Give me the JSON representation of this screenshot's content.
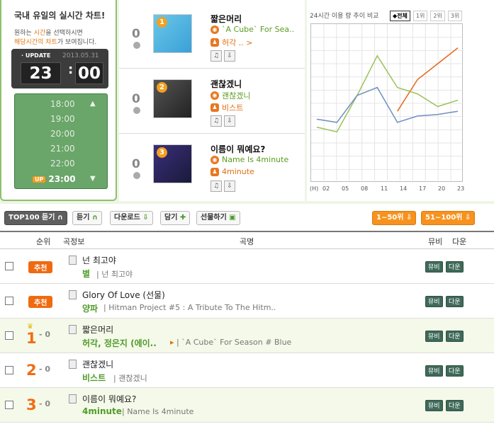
{
  "left": {
    "title": "국내 유일의 실시간 차트!",
    "sub1": "원하는 ",
    "sub_hl1": "시간",
    "sub2": "을 선택하시면",
    "sub_hl2": "해당시간의 차트",
    "sub3": "가 보여집니다.",
    "update_label": "· UPDATE",
    "update_date": "2013.05.31",
    "hour": "23",
    "minute": "00",
    "times": [
      "18:00",
      "19:00",
      "20:00",
      "21:00",
      "22:00"
    ],
    "up_badge": "UP",
    "current_time": "23:00"
  },
  "top_chart": [
    {
      "rank": "1",
      "change": "0",
      "title": "짧은머리",
      "album": "`A Cube` For Sea..",
      "artist": "허각 .. >"
    },
    {
      "rank": "2",
      "change": "0",
      "title": "괜찮겠니",
      "album": "괜찮겠니",
      "artist": "비스트"
    },
    {
      "rank": "3",
      "change": "0",
      "title": "이름이 뭐예요?",
      "album": "Name Is 4minute",
      "artist": "4minute"
    }
  ],
  "graph": {
    "title": "24시간 이용 량 추이 비교",
    "legend": [
      "◆전체",
      "1위",
      "2위",
      "3위"
    ],
    "x_label": "(H)",
    "x_ticks": [
      "02",
      "05",
      "08",
      "11",
      "14",
      "17",
      "20",
      "23"
    ],
    "colors": {
      "rank1": "#e8671a",
      "rank2": "#9cc25a",
      "rank3": "#6f8fc0"
    }
  },
  "chart_data": {
    "type": "line",
    "title": "24시간 이용 량 추이 비교",
    "x": [
      "02",
      "05",
      "08",
      "11",
      "14",
      "17",
      "20",
      "23"
    ],
    "series": [
      {
        "name": "1위",
        "values": [
          null,
          null,
          null,
          null,
          45,
          65,
          75,
          85
        ]
      },
      {
        "name": "2위",
        "values": [
          35,
          32,
          55,
          80,
          60,
          56,
          48,
          52
        ]
      },
      {
        "name": "3위",
        "values": [
          40,
          38,
          55,
          60,
          38,
          42,
          43,
          45
        ]
      }
    ],
    "ylim": [
      0,
      100
    ],
    "grid": true
  },
  "actions": {
    "top100": "TOP100 듣기",
    "listen": "듣기",
    "download": "다운로드",
    "add": "담기",
    "gift": "선물하기",
    "range1": "1~50위",
    "range2": "51~100위"
  },
  "list_header": {
    "rank": "순위",
    "info": "곡정보",
    "song": "곡명",
    "mv": "뮤비",
    "down": "다운"
  },
  "rows": [
    {
      "badge": "추천",
      "title": "넌 최고야",
      "artist": "별",
      "album": "넌 최고야",
      "mv": "뮤비",
      "down": "다운"
    },
    {
      "badge": "추천",
      "title": "Glory Of Love (선물)",
      "artist": "양파",
      "album": "Hitman Project #5 : A Tribute To The Hitm..",
      "mv": "뮤비",
      "down": "다운"
    },
    {
      "rank": "1",
      "change": "- 0",
      "title": "짧은머리",
      "artist": "허각, 정은지 (에이..",
      "album": "`A Cube` For Season # Blue",
      "mv": "뮤비",
      "down": "다운"
    },
    {
      "rank": "2",
      "change": "- 0",
      "title": "괜찮겠니",
      "artist": "비스트",
      "album": "괜찮겠니",
      "mv": "뮤비",
      "down": "다운"
    },
    {
      "rank": "3",
      "change": "- 0",
      "title": "이름이 뭐예요?",
      "artist": "4minute",
      "album": "Name Is 4minute",
      "mv": "뮤비",
      "down": "다운"
    }
  ]
}
